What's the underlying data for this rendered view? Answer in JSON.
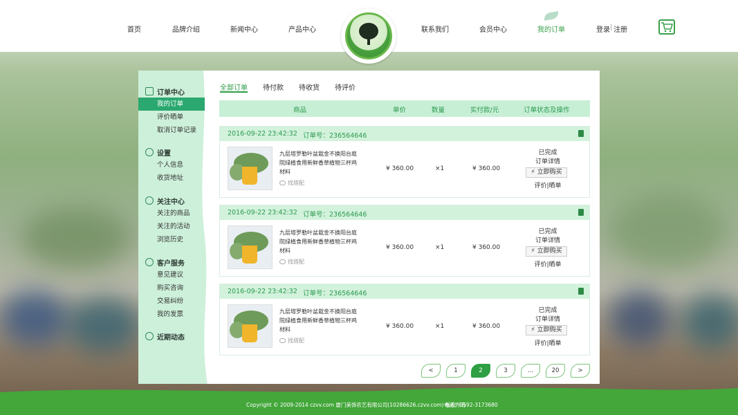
{
  "nav": {
    "left": [
      "首页",
      "品牌介绍",
      "新闻中心",
      "产品中心"
    ],
    "right": [
      "联系我们",
      "会员中心",
      "我的订单"
    ],
    "active": "我的订单",
    "login": "登录",
    "separator": "|",
    "register": "注册"
  },
  "sidebar": {
    "groups": [
      {
        "title": "订单中心",
        "icon": "clipboard-icon",
        "items": [
          "我的订单",
          "评价晒单",
          "取消订单记录"
        ]
      },
      {
        "title": "设置",
        "icon": "gear-icon",
        "items": [
          "个人信息",
          "收货地址"
        ]
      },
      {
        "title": "关注中心",
        "icon": "heart-icon",
        "items": [
          "关注的商品",
          "关注的活动",
          "浏览历史"
        ]
      },
      {
        "title": "客户服务",
        "icon": "headset-icon",
        "items": [
          "意见建议",
          "购买咨询",
          "交易纠纷",
          "我的发票"
        ]
      },
      {
        "title": "近期动态",
        "icon": "clock-icon",
        "items": []
      }
    ],
    "active_item": "我的订单"
  },
  "tabs": [
    "全部订单",
    "待付款",
    "待收货",
    "待评价"
  ],
  "table_headers": {
    "product": "商品",
    "unit_price": "单价",
    "quantity": "数量",
    "paid": "实付款/元",
    "status": "订单状态及操作"
  },
  "orders": [
    {
      "datetime": "2016-09-22 23:42:32",
      "order_no": "订单号：236564646",
      "product_name": "九层塔罗勒叶盆栽金不换阳台庭院绿植食用新鲜香草植物三杯鸡材料",
      "match_label": "找搭配",
      "price": "¥ 360.00",
      "qty": "×1",
      "paid": "¥ 360.00",
      "status": "已完成",
      "detail": "订单详情",
      "buy_again": "立即购买",
      "review": "评价|晒单"
    },
    {
      "datetime": "2016-09-22 23:42:32",
      "order_no": "订单号：236564646",
      "product_name": "九层塔罗勒叶盆栽金不换阳台庭院绿植食用新鲜香草植物三杯鸡材料",
      "match_label": "找搭配",
      "price": "¥ 360.00",
      "qty": "×1",
      "paid": "¥ 360.00",
      "status": "已完成",
      "detail": "订单详情",
      "buy_again": "立即购买",
      "review": "评价|晒单"
    },
    {
      "datetime": "2016-09-22 23:42:32",
      "order_no": "订单号：236564646",
      "product_name": "九层塔罗勒叶盆栽金不换阳台庭院绿植食用新鲜香草植物三杯鸡材料",
      "match_label": "找搭配",
      "price": "¥ 360.00",
      "qty": "×1",
      "paid": "¥ 360.00",
      "status": "已完成",
      "detail": "订单详情",
      "buy_again": "立即购买",
      "review": "评价|晒单"
    }
  ],
  "pager": {
    "prev": "<",
    "pages": [
      "1",
      "2",
      "3",
      "...",
      "20"
    ],
    "active": "2",
    "next": ">"
  },
  "footer": {
    "copyright": "Copyright © 2009-2014 czvv.com  厦门美饰农艺有限公司(10286626.czvv.com) 版权所有",
    "phone": "电话：0592-3173680"
  },
  "colors": {
    "brand_green": "#2ea043",
    "header_bg": "#c7efd6",
    "sidebar_active": "#2aa86f",
    "footer_bg": "#43a73a"
  }
}
